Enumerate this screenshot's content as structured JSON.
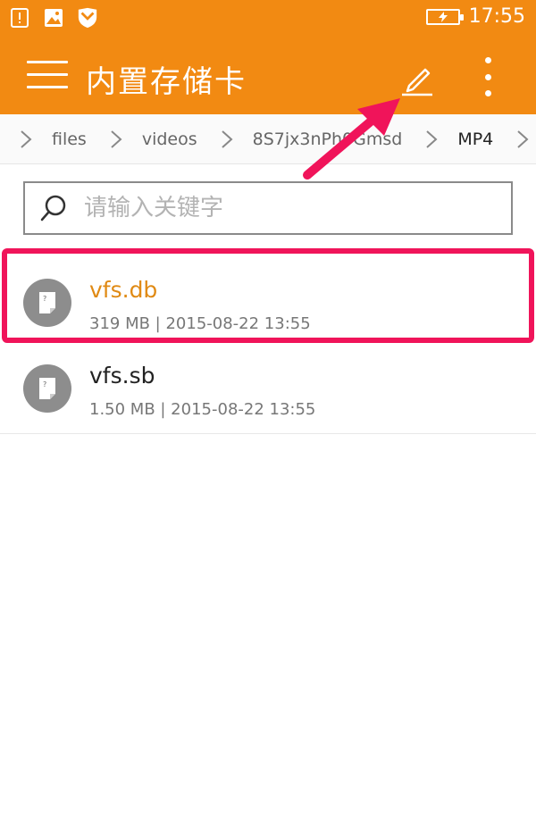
{
  "status_bar": {
    "time": "17:55",
    "icons": [
      "notification-alert-icon",
      "gallery-icon",
      "shield-icon",
      "battery-charging-icon"
    ]
  },
  "app_bar": {
    "title": "内置存储卡",
    "menu_icon": "hamburger-menu-icon",
    "edit_icon": "pencil-icon",
    "more_icon": "more-vert-icon"
  },
  "breadcrumb": {
    "items": [
      {
        "label": "files"
      },
      {
        "label": "videos"
      },
      {
        "label": "8S7jx3nPh0Gmsd"
      },
      {
        "label": "MP4"
      }
    ]
  },
  "search": {
    "placeholder": "请输入关键字",
    "value": ""
  },
  "files": [
    {
      "name": "vfs.db",
      "meta": "319 MB | 2015-08-22 13:55",
      "selected": true,
      "icon": "unknown-file-icon"
    },
    {
      "name": "vfs.sb",
      "meta": "1.50 MB | 2015-08-22 13:55",
      "selected": false,
      "icon": "unknown-file-icon"
    }
  ],
  "colors": {
    "accent": "#f28a12",
    "highlight": "#f0145a",
    "selected_text": "#e08a14"
  }
}
